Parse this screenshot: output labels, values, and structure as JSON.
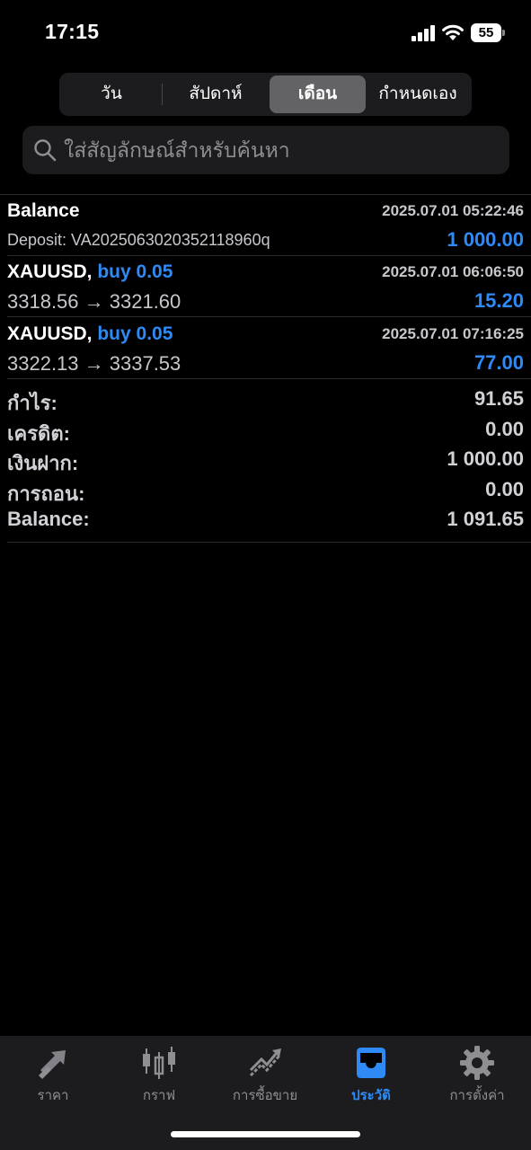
{
  "status_bar": {
    "time": "17:15",
    "battery": "55"
  },
  "period_tabs": [
    {
      "label": "วัน",
      "active": false
    },
    {
      "label": "สัปดาห์",
      "active": false
    },
    {
      "label": "เดือน",
      "active": true
    },
    {
      "label": "กำหนดเอง",
      "active": false
    }
  ],
  "search": {
    "placeholder": "ใส่สัญลักษณ์สำหรับค้นหา"
  },
  "history": [
    {
      "title": "Balance",
      "direction": "",
      "time": "2025.07.01 05:22:46",
      "subtitle": "Deposit: VA2025063020352118960q",
      "amount": "1 000.00"
    },
    {
      "title": "XAUUSD,",
      "direction": "buy 0.05",
      "time": "2025.07.01 06:06:50",
      "subtitle": "3318.56 → 3321.60",
      "amount": "15.20"
    },
    {
      "title": "XAUUSD,",
      "direction": "buy 0.05",
      "time": "2025.07.01 07:16:25",
      "subtitle": "3322.13 → 3337.53",
      "amount": "77.00"
    }
  ],
  "summary": [
    {
      "label": "กำไร:",
      "value": "91.65"
    },
    {
      "label": "เครดิต:",
      "value": "0.00"
    },
    {
      "label": "เงินฝาก:",
      "value": "1 000.00"
    },
    {
      "label": "การถอน:",
      "value": "0.00"
    },
    {
      "label": "Balance:",
      "value": "1 091.65"
    }
  ],
  "tabbar": [
    {
      "label": "ราคา",
      "icon": "quotes-arrows-icon",
      "active": false
    },
    {
      "label": "กราฟ",
      "icon": "candlestick-chart-icon",
      "active": false
    },
    {
      "label": "การซื้อขาย",
      "icon": "trade-trend-icon",
      "active": false
    },
    {
      "label": "ประวัติ",
      "icon": "history-inbox-icon",
      "active": true
    },
    {
      "label": "การตั้งค่า",
      "icon": "gear-icon",
      "active": false
    }
  ],
  "colors": {
    "accent": "#2f8af5",
    "background": "#000000",
    "surface": "#1c1c1e"
  }
}
